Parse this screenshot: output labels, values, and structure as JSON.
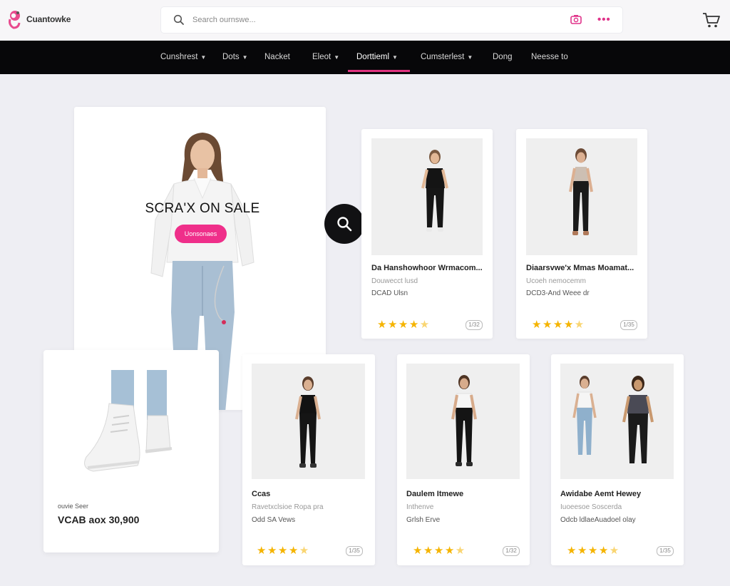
{
  "brand": {
    "name": "Cuantowke"
  },
  "search": {
    "placeholder": "Search ournswe..."
  },
  "nav": {
    "items": [
      {
        "label": "Cunshrest",
        "caret": true
      },
      {
        "label": "Dots",
        "caret": true
      },
      {
        "label": "Nacket",
        "caret": false
      },
      {
        "label": "Eleot",
        "caret": true
      },
      {
        "label": "Dorttieml",
        "caret": true
      },
      {
        "label": "Cumsterlest",
        "caret": true
      },
      {
        "label": "Dong",
        "caret": false
      },
      {
        "label": "Neesse to",
        "caret": false
      }
    ],
    "active_index": 4
  },
  "hero": {
    "title": "SCRA'X ON SALE",
    "button": "Uonsonaes"
  },
  "shoe": {
    "kicker": "ouvie Seer",
    "value": "VCAB aox 30,900"
  },
  "products": [
    {
      "name": "Da Hanshowhoor Wrmacom...",
      "sub": "Douwecct lusd",
      "price": "DCAD Ulsn",
      "rating": 4.5,
      "count": "1/32"
    },
    {
      "name": "Diaarsvwe'x Mmas Moamat...",
      "sub": "Ucoeh nemocemm",
      "price": "DCD3-And Weee dr",
      "rating": 4.5,
      "count": "1/35"
    },
    {
      "name": "Ccas",
      "sub": "Ravetxclsioe Ropa pra",
      "price": "Odd SA Vews",
      "rating": 4.5,
      "count": "1/35"
    },
    {
      "name": "Daulem Itmewe",
      "sub": "Inthenve",
      "price": "Grlsh Erve",
      "rating": 4.5,
      "count": "1/32"
    },
    {
      "name": "Awidabe Aemt Hewey",
      "sub": "Iuoeesoe Soscerda",
      "price": "Odcb ldlaeAuadoel olay",
      "rating": 4.5,
      "count": "1/35"
    }
  ],
  "colors": {
    "accent": "#ef2f8a",
    "nav_bg": "#070709",
    "page_bg": "#eeeef3",
    "star": "#f5b400"
  }
}
